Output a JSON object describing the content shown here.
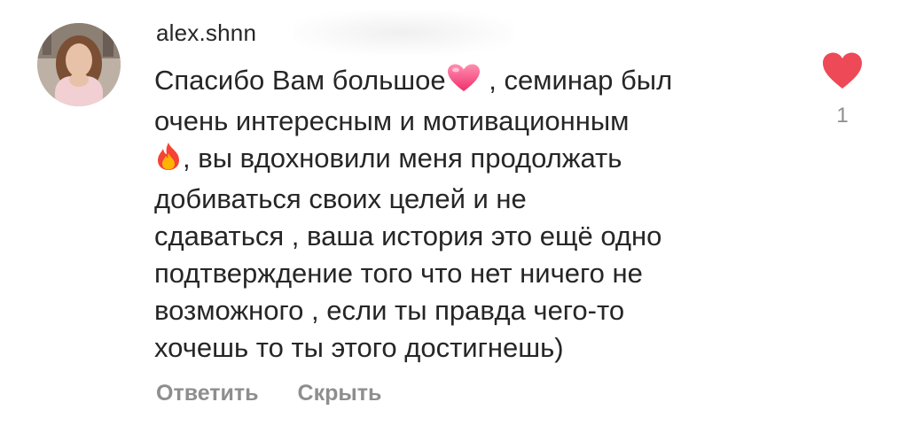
{
  "comment": {
    "username": "alex.shnn",
    "text_lines": [
      "Спасибо Вам большое",
      ", семинар был",
      "очень интересным и мотивационным",
      ", вы вдохновили меня продолжать",
      "добиваться своих целей и не",
      "сдаваться , ваша история это ещё одно",
      "подтверждение того что нет ничего не",
      "возможного , если ты правда чего-то",
      "хочешь то ты этого достигнешь)"
    ],
    "emojis": [
      "heart-emoji",
      "fire-emoji"
    ],
    "like_count": "1",
    "like_color": "#ed4956",
    "actions": {
      "reply_label": "Ответить",
      "hide_label": "Скрыть"
    }
  }
}
